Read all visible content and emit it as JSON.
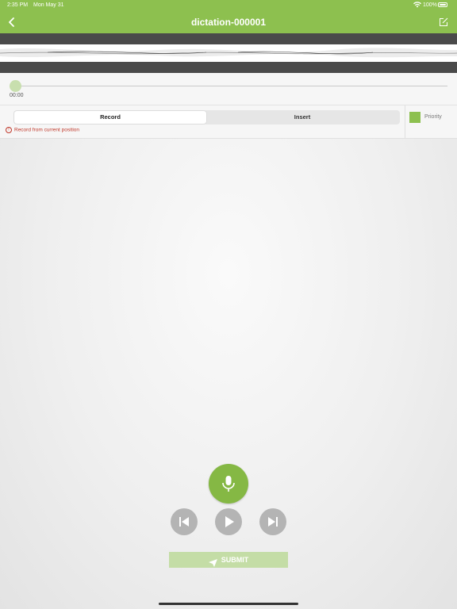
{
  "status_bar": {
    "time": "2:35 PM",
    "date": "Mon May 31",
    "battery": "100%",
    "wifi_icon": "wifi-icon",
    "battery_icon": "battery-icon"
  },
  "header": {
    "title": "dictation-000001",
    "back_icon": "chevron-left-icon",
    "edit_icon": "edit-icon",
    "background_color": "#8dc04f"
  },
  "player": {
    "position_label": "00:00",
    "position_fraction": 0
  },
  "mode": {
    "options": [
      "Record",
      "Insert"
    ],
    "selected": "Record",
    "hint": "Record from current position",
    "priority_label": "Priority"
  },
  "controls": {
    "mic_icon": "microphone-icon",
    "prev_icon": "skip-back-icon",
    "play_icon": "play-icon",
    "next_icon": "skip-forward-icon",
    "submit_label": "SUBMIT",
    "submit_icon": "send-icon"
  },
  "colors": {
    "accent": "#8dc04f",
    "mic": "#85b844",
    "controls": "#b4b4b4",
    "submit_disabled": "#c4dda6",
    "hint": "#c0392b"
  }
}
